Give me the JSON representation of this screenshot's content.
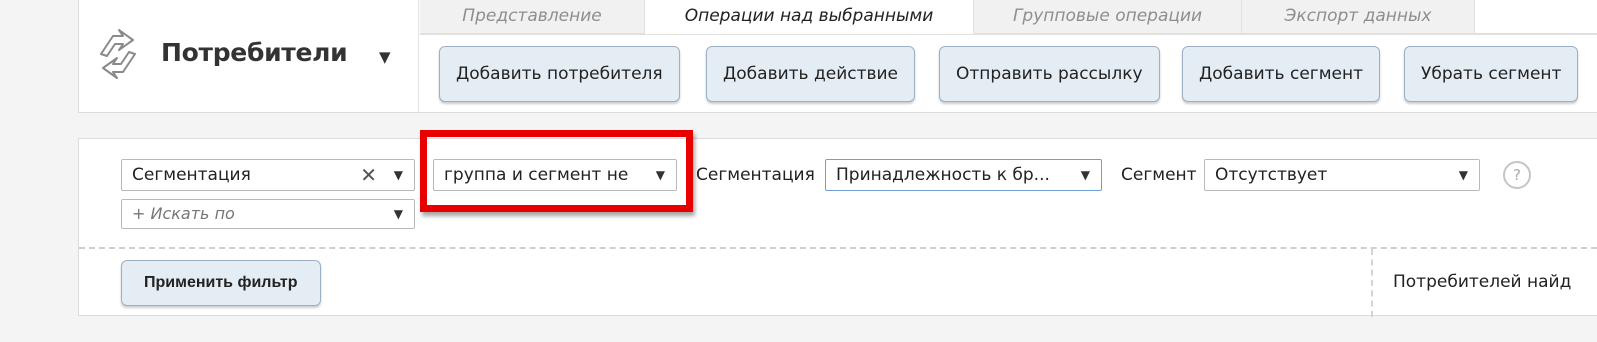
{
  "header": {
    "title": "Потребители",
    "tabs": [
      {
        "label": "Представление"
      },
      {
        "label": "Операции над выбранными"
      },
      {
        "label": "Групповые операции"
      },
      {
        "label": "Экспорт данных"
      }
    ],
    "actions": [
      {
        "label": "Добавить потребителя"
      },
      {
        "label": "Добавить действие"
      },
      {
        "label": "Отправить рассылку"
      },
      {
        "label": "Добавить сегмент"
      },
      {
        "label": "Убрать сегмент"
      }
    ]
  },
  "filter": {
    "field_select": "Сегментация",
    "search_placeholder": "+ Искать по",
    "condition_select": "группа и сегмент не",
    "segmentation_label": "Сегментация",
    "segmentation_value": "Принадлежность к бр...",
    "segment_label": "Сегмент",
    "segment_value": "Отсутствует",
    "help_symbol": "?",
    "apply_label": "Применить фильтр",
    "found_text": "Потребителей найд"
  },
  "glyphs": {
    "clear": "✕",
    "dropdown": "▼"
  },
  "colors": {
    "highlight": "#e80000",
    "button_bg": "#e4edf4",
    "accent_border": "#6f9fd6"
  }
}
